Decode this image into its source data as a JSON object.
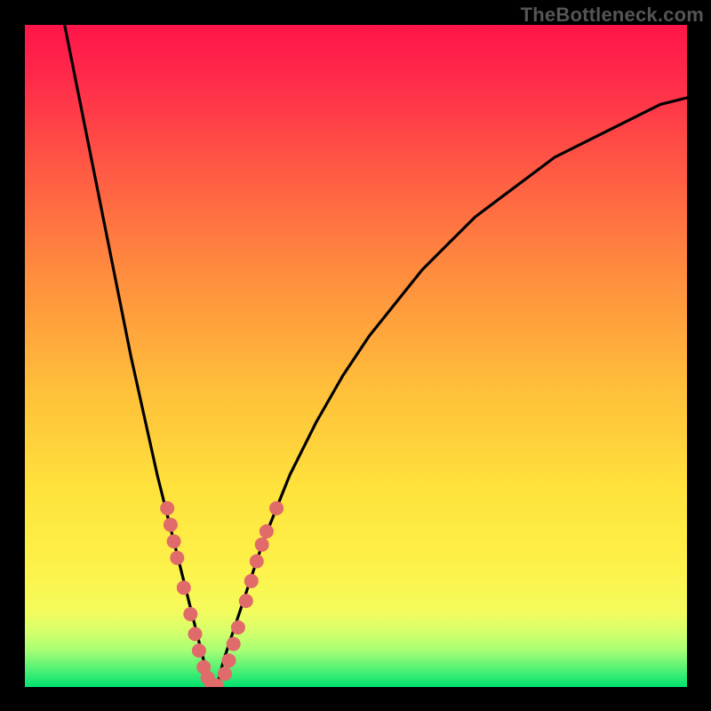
{
  "watermark": "TheBottleneck.com",
  "colors": {
    "gradient_top": "#ff1a4b",
    "gradient_mid": "#ffd23a",
    "gradient_green_band": "#d8ff66",
    "gradient_bottom": "#00e270",
    "curve": "#000000",
    "marker": "#e16a6a",
    "frame": "#000000"
  },
  "chart_data": {
    "type": "line",
    "title": "",
    "xlabel": "",
    "ylabel": "",
    "xlim": [
      0,
      100
    ],
    "ylim": [
      0,
      100
    ],
    "note": "Bottleneck-style V-curve. y≈0 at the notch near x≈28; y rises steeply to the left and more gradually to the right.",
    "series": [
      {
        "name": "bottleneck-curve",
        "x": [
          6,
          8,
          10,
          12,
          14,
          16,
          18,
          20,
          22,
          24,
          26,
          27,
          28,
          29,
          30,
          32,
          34,
          36,
          38,
          40,
          44,
          48,
          52,
          56,
          60,
          64,
          68,
          72,
          76,
          80,
          84,
          88,
          92,
          96,
          100
        ],
        "y": [
          100,
          90,
          80,
          70,
          60,
          50,
          41,
          32,
          24,
          16,
          8,
          4,
          0,
          0,
          4,
          10,
          16,
          22,
          27,
          32,
          40,
          47,
          53,
          58,
          63,
          67,
          71,
          74,
          77,
          80,
          82,
          84,
          86,
          88,
          89
        ]
      }
    ],
    "markers": [
      {
        "name": "left-cluster",
        "points": [
          {
            "x": 21.5,
            "y": 27
          },
          {
            "x": 22,
            "y": 24.5
          },
          {
            "x": 22.5,
            "y": 22
          },
          {
            "x": 23,
            "y": 19.5
          },
          {
            "x": 24,
            "y": 15
          },
          {
            "x": 25,
            "y": 11
          },
          {
            "x": 25.7,
            "y": 8
          },
          {
            "x": 26.3,
            "y": 5.5
          },
          {
            "x": 27,
            "y": 3
          },
          {
            "x": 27.6,
            "y": 1.4
          },
          {
            "x": 28.2,
            "y": 0.4
          },
          {
            "x": 29,
            "y": 0.2
          }
        ]
      },
      {
        "name": "right-cluster",
        "points": [
          {
            "x": 30.2,
            "y": 2
          },
          {
            "x": 30.8,
            "y": 4
          },
          {
            "x": 31.5,
            "y": 6.5
          },
          {
            "x": 32.2,
            "y": 9
          },
          {
            "x": 33.4,
            "y": 13
          },
          {
            "x": 34.2,
            "y": 16
          },
          {
            "x": 35,
            "y": 19
          },
          {
            "x": 35.8,
            "y": 21.5
          },
          {
            "x": 36.5,
            "y": 23.5
          },
          {
            "x": 38,
            "y": 27
          }
        ]
      }
    ]
  }
}
